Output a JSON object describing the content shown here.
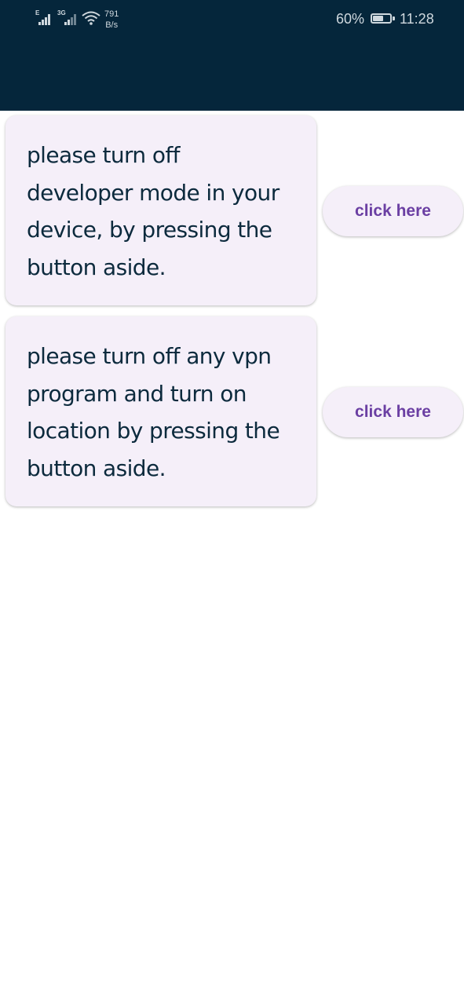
{
  "status_bar": {
    "signal1_label": "E",
    "signal2_label": "3G",
    "net_speed_value": "791",
    "net_speed_unit": "B/s",
    "battery_percent": "60%",
    "battery_level": 0.6,
    "time": "11:28",
    "icons": [
      "signal-icon",
      "signal-icon",
      "wifi-icon",
      "battery-icon"
    ]
  },
  "header": {
    "color": "#05263b"
  },
  "cards": [
    {
      "message": "please turn off\ndeveloper mode in your\ndevice, by pressing the\nbutton aside.",
      "button_label": "click here"
    },
    {
      "message": "please turn off any vpn\nprogram and turn on\nlocation by pressing the\nbutton aside.",
      "button_label": "click here"
    }
  ],
  "colors": {
    "card_background": "#f5eff9",
    "text": "#0c2a3d",
    "button_text": "#6b3fa3"
  }
}
